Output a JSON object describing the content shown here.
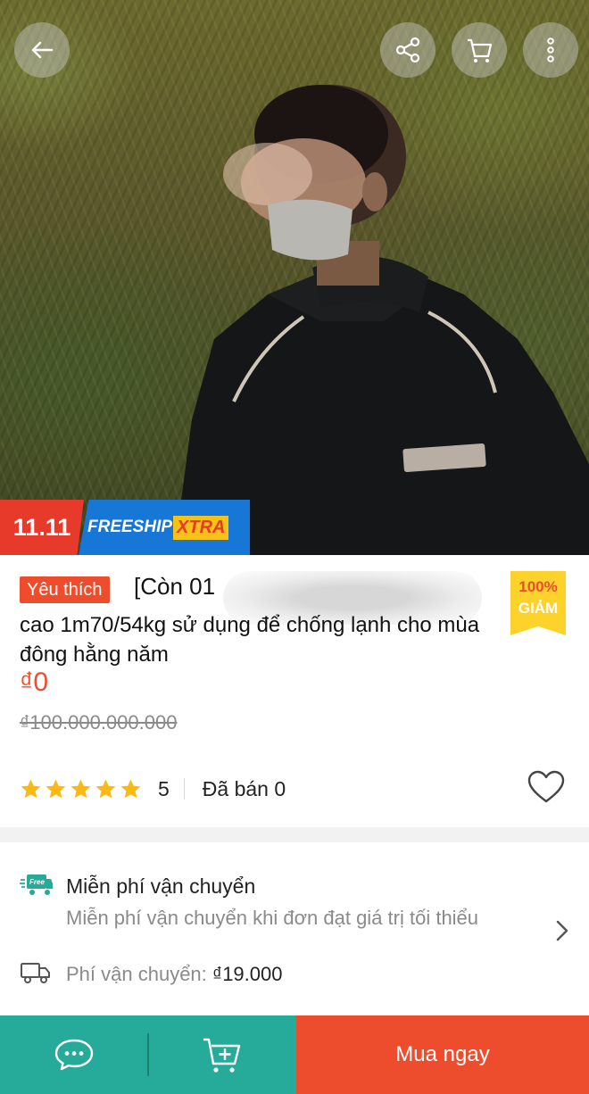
{
  "hero": {
    "promo": {
      "date": "11.11",
      "freeship": "FREESHIP",
      "xtra": "XTRA"
    },
    "top_buttons": [
      "back-arrow-icon",
      "share-icon",
      "cart-icon",
      "more-icon"
    ]
  },
  "product": {
    "badge": "Yêu thích",
    "title_line1": "[Còn 01",
    "title_rest": "cao 1m70/54kg sử dụng để chống lạnh cho mùa đông hằng năm",
    "discount": {
      "percent": "100%",
      "label": "GIẢM"
    },
    "price": "₫0",
    "old_price": "₫100.000.000.000",
    "rating": "5",
    "rating_stars": 5,
    "sold": "Đã bán 0"
  },
  "shipping": {
    "free_title": "Miễn phí vận chuyển",
    "free_sub": "Miễn phí vận chuyển khi đơn đạt giá trị tối thiểu",
    "free_icon_text": "Free",
    "fee_label": "Phí vận chuyển:",
    "fee_amount": "₫19.000"
  },
  "bottom_bar": {
    "buy_label": "Mua ngay"
  },
  "colors": {
    "accent": "#ee4d2d",
    "teal": "#26aa99",
    "discount_yellow": "#fdd32b",
    "star": "#fdb913"
  }
}
